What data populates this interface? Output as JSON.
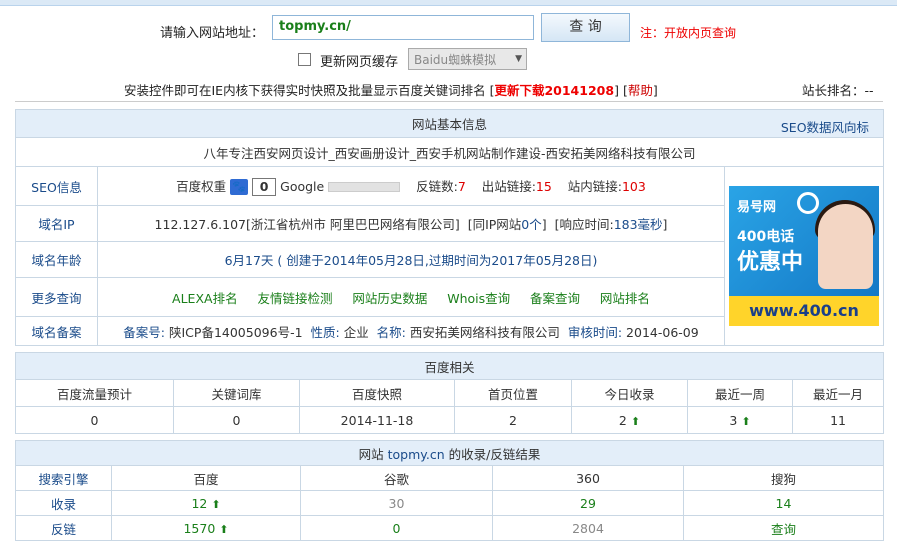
{
  "search": {
    "label": "请输入网站地址：",
    "value": "topmy.cn/",
    "button": "查 询",
    "note": "注：开放内页查询",
    "cache_label": "更新网页缓存",
    "spider_select": "Baidu蜘蛛模拟"
  },
  "notice": {
    "text": "安装控件即可在IE内核下获得实时快照及批量显示百度关键词排名",
    "bracket_open": "[",
    "download": "更新下载20141208",
    "bracket_close": "]",
    "help_open": "[",
    "help": "帮助",
    "help_close": "]",
    "rank": "站长排名：--"
  },
  "basic": {
    "title": "网站基本信息",
    "trend_link": "SEO数据风向标",
    "site_title": "八年专注西安网页设计_西安画册设计_西安手机网站制作建设-西安拓美网络科技有限公司",
    "seo_label": "SEO信息",
    "baidu_weight_label": "百度权重",
    "paw": "🐾",
    "baidu_weight": "0",
    "google_label": "Google",
    "backlinks_label": "反链数:",
    "backlinks": "7",
    "outlinks_label": "出站链接:",
    "outlinks": "15",
    "inlinks_label": "站内链接:",
    "inlinks": "103",
    "ip_label": "域名IP",
    "ip": "112.127.6.107[浙江省杭州市 阿里巴巴网络有限公司]",
    "same_ip_open": "[同IP网站",
    "same_ip_count": "0个",
    "same_ip_close": "]",
    "resp_open": "[响应时间:",
    "resp_time": "183毫秒",
    "resp_close": "]",
    "age_label": "域名年龄",
    "age": "6月17天",
    "age_mid1": "( 创建于",
    "created": "2014年05月28日",
    "age_mid2": ",过期时间为",
    "expires": "2017年05月28日",
    "age_end": ")",
    "more_label": "更多查询",
    "more_links": [
      "ALEXA排名",
      "友情链接检测",
      "网站历史数据",
      "Whois查询",
      "备案查询",
      "网站排名"
    ],
    "icp_label": "域名备案",
    "icp_no_label": "备案号:",
    "icp_no": "陕ICP备14005096号-1",
    "icp_type_label": "性质:",
    "icp_type": "企业",
    "icp_name_label": "名称:",
    "icp_name": "西安拓美网络科技有限公司",
    "icp_date_label": "审核时间:",
    "icp_date": "2014-06-09"
  },
  "ad": {
    "brand": "易号网",
    "line1": "400电话",
    "line2": "优惠中",
    "url": "www.400.cn"
  },
  "baidu": {
    "title": "百度相关",
    "headers": [
      "百度流量预计",
      "关键词库",
      "百度快照",
      "首页位置",
      "今日收录",
      "最近一周",
      "最近一月"
    ],
    "values": [
      "0",
      "0",
      "2014-11-18",
      "2",
      "2",
      "3",
      "11"
    ]
  },
  "index": {
    "title_pre": "网站",
    "title_site": "topmy.cn",
    "title_post": "的收录/反链结果",
    "engine_label": "搜索引擎",
    "engines": [
      "百度",
      "谷歌",
      "360",
      "搜狗"
    ],
    "collect_label": "收录",
    "collect": [
      "12",
      "30",
      "29",
      "14"
    ],
    "backlink_label": "反链",
    "backlink": [
      "1570",
      "0",
      "2804",
      "查询"
    ]
  }
}
